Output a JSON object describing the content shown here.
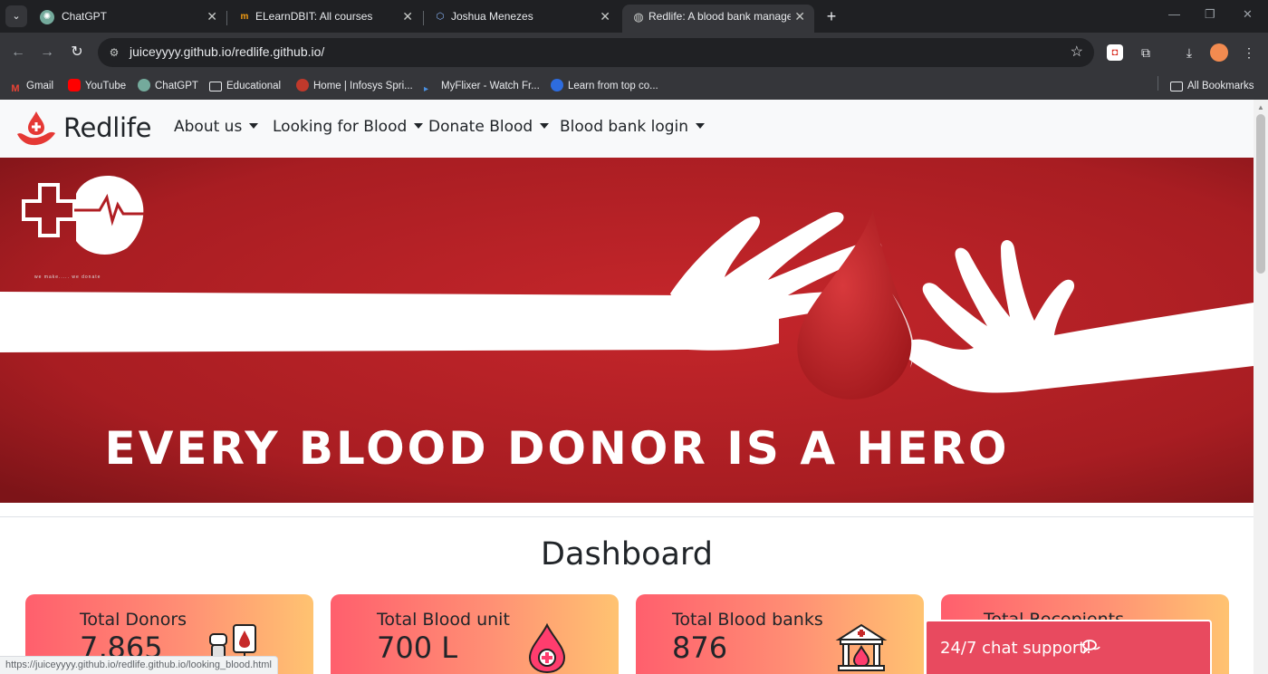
{
  "browser": {
    "tabs": [
      {
        "title": "ChatGPT",
        "icon": "chatgpt-icon",
        "active": false
      },
      {
        "title": "ELearnDBIT: All courses",
        "icon": "moodle-icon",
        "active": false
      },
      {
        "title": "Joshua Menezes",
        "icon": "hexagon-icon",
        "active": false
      },
      {
        "title": "Redlife: A blood bank manage",
        "icon": "globe-icon",
        "active": true
      }
    ],
    "url": "juiceyyyy.github.io/redlife.github.io/",
    "bookmarks": [
      {
        "label": "Gmail",
        "icon": "gmail-icon",
        "color": "#ea4335"
      },
      {
        "label": "YouTube",
        "icon": "youtube-icon",
        "color": "#ff0000"
      },
      {
        "label": "ChatGPT",
        "icon": "chatgpt-icon",
        "color": "#74aa9c"
      },
      {
        "label": "Educational",
        "icon": "folder-icon",
        "color": "#e8eaed"
      },
      {
        "label": "Home | Infosys Spri...",
        "icon": "infosys-icon",
        "color": "#c0392b"
      },
      {
        "label": "MyFlixer - Watch Fr...",
        "icon": "play-icon",
        "color": "#4a90e2"
      },
      {
        "label": "Learn from top co...",
        "icon": "blue-logo-icon",
        "color": "#2d6cdf"
      }
    ],
    "all_bookmarks": "All Bookmarks",
    "status_url": "https://juiceyyyy.github.io/redlife.github.io/looking_blood.html"
  },
  "site": {
    "brand": "Redlife",
    "nav": [
      {
        "label": "About us"
      },
      {
        "label": "Looking for Blood"
      },
      {
        "label": "Donate Blood"
      },
      {
        "label": "Blood bank login"
      }
    ],
    "hero": {
      "headline": "EVERY BLOOD DONOR IS A HERO",
      "logo_caption": "we make..... we donate"
    },
    "dashboard": {
      "title": "Dashboard",
      "cards": [
        {
          "label": "Total Donors",
          "value": "7,865",
          "icon": "donor-icon"
        },
        {
          "label": "Total Blood unit",
          "value": "700 L",
          "icon": "blood-drop-icon"
        },
        {
          "label": "Total Blood banks",
          "value": "876",
          "icon": "blood-bank-icon"
        },
        {
          "label": "Total Recepients",
          "value": "",
          "icon": ""
        }
      ]
    },
    "chat": {
      "label": "24/7 chat support!",
      "icon": "chat-icon"
    }
  },
  "colors": {
    "brand_red": "#e84a5f",
    "card_gradient_start": "#ff5f6d",
    "card_gradient_end": "#ffc371",
    "hero_red": "#9e1b20"
  }
}
